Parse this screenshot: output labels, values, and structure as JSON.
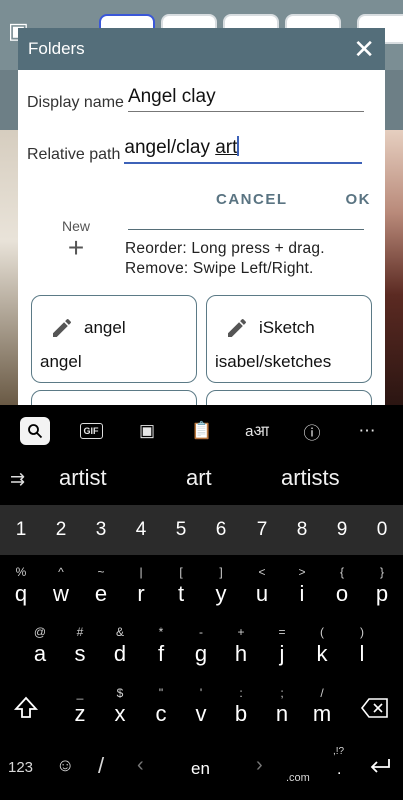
{
  "dialog": {
    "title": "Folders",
    "display_name_label": "Display name",
    "display_name_value": "Angel clay",
    "relative_path_label": "Relative path",
    "relative_path_prefix": "angel/clay ",
    "relative_path_word": "art",
    "cancel_label": "CANCEL",
    "ok_label": "OK",
    "new_label": "New",
    "hint_reorder": "Reorder: Long press + drag.",
    "hint_remove": "Remove: Swipe Left/Right.",
    "folders": [
      {
        "name": "angel",
        "path": "angel"
      },
      {
        "name": "iSketch",
        "path": "isabel/sketches"
      }
    ]
  },
  "keyboard": {
    "suggestions": [
      "artist",
      "art",
      "artists"
    ],
    "numbers": [
      "1",
      "2",
      "3",
      "4",
      "5",
      "6",
      "7",
      "8",
      "9",
      "0"
    ],
    "row1_letters": [
      "q",
      "w",
      "e",
      "r",
      "t",
      "y",
      "u",
      "i",
      "o",
      "p"
    ],
    "row1_symbols": [
      "%",
      "^",
      "~",
      "|",
      "[",
      "]",
      "<",
      ">",
      "{",
      "}"
    ],
    "row2_letters": [
      "a",
      "s",
      "d",
      "f",
      "g",
      "h",
      "j",
      "k",
      "l"
    ],
    "row2_symbols": [
      "@",
      "#",
      "&",
      "*",
      "-",
      "+",
      "=",
      "(",
      ")"
    ],
    "row3_letters": [
      "z",
      "x",
      "c",
      "v",
      "b",
      "n",
      "m"
    ],
    "row3_symbols": [
      "_",
      "$",
      "\"",
      "'",
      ":",
      ";",
      "/"
    ],
    "symbols_key": "123",
    "slash_key": "/",
    "language_key": "en",
    "period_key": ".",
    "period_sub": ",!?",
    "com_key": ".com",
    "toolbar_gif": "GIF"
  },
  "colors": {
    "dialog_header": "#546e7a",
    "accent": "#3d62b8",
    "keyboard_bg": "#000000",
    "number_row_bg": "#2b2b2b"
  }
}
